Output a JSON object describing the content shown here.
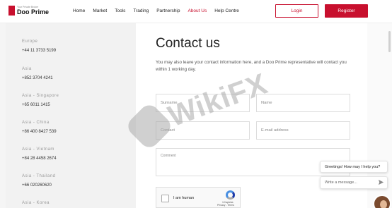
{
  "header": {
    "logo_tagline": "Your Private Broker",
    "logo_name": "Doo Prime",
    "nav": [
      "Home",
      "Market",
      "Tools",
      "Trading",
      "Partnership",
      "About Us",
      "Help Centre"
    ],
    "active_nav": "About Us",
    "login_label": "Login",
    "register_label": "Register"
  },
  "offices": [
    {
      "region": "Europe",
      "phone": "+44 11 3733 5199"
    },
    {
      "region": "Asia",
      "phone": "+852 3704 4241"
    },
    {
      "region": "Asia - Singapore",
      "phone": "+65 6011 1415"
    },
    {
      "region": "Asia - China",
      "phone": "+86 400 8427 539"
    },
    {
      "region": "Asia - Vietnam",
      "phone": "+84 28 4458 2674"
    },
    {
      "region": "Asia - Thailand",
      "phone": "+66 020260620"
    },
    {
      "region": "Asia - Korea",
      "phone": ""
    }
  ],
  "contact": {
    "title": "Contact us",
    "description": "You may also leave your contact information here, and a Doo Prime representative will contact you within 1 working day.",
    "surname_placeholder": "Surname",
    "name_placeholder": "Name",
    "contact_placeholder": "Contact",
    "email_placeholder": "E-mail address",
    "comment_placeholder": "Comment"
  },
  "captcha": {
    "label": "I am human",
    "brand": "hCaptcha",
    "links": "Privacy - Terms"
  },
  "chat": {
    "greeting": "Greetings! How may I help you?",
    "input_placeholder": "Write a message..."
  },
  "watermark": "WikiFX",
  "colors": {
    "brand": "#c8102e",
    "panel_bg": "#f2f2f2"
  }
}
